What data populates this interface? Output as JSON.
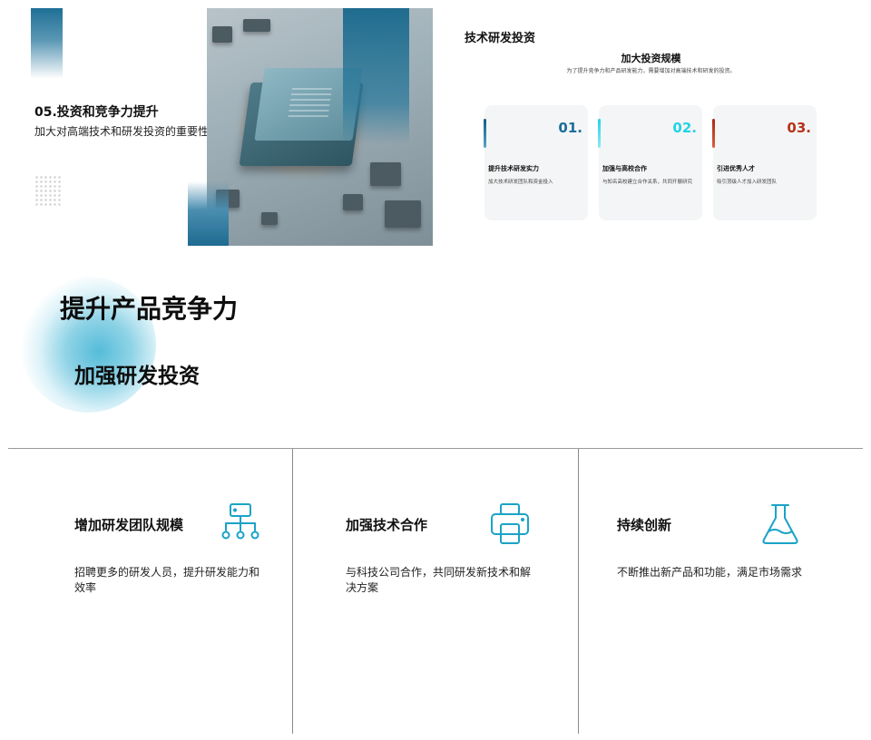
{
  "slide1": {
    "title": "05.投资和竞争力提升",
    "subtitle": "加大对高端技术和研发投资的重要性"
  },
  "slide2": {
    "heading": "技术研发投资",
    "title": "加大投资规模",
    "description": "为了提升竞争力和产品研发能力，需要增加对高端技术和研发的投资。",
    "cards": [
      {
        "num": "01.",
        "title": "提升技术研发实力",
        "text": "加大技术研发团队和资金投入",
        "color": "#1a6e9a"
      },
      {
        "num": "02.",
        "title": "加强与高校合作",
        "text": "与知名高校建立合作关系，共同开展研究",
        "color": "#22d3e6"
      },
      {
        "num": "03.",
        "title": "引进优秀人才",
        "text": "吸引顶级人才加入研发团队",
        "color": "#b8321a"
      }
    ]
  },
  "slide3": {
    "line1": "提升产品竞争力",
    "line2": "加强研发投资"
  },
  "slide4": {
    "accent": "#1aa3c7",
    "columns": [
      {
        "title": "增加研发团队规模",
        "text": "招聘更多的研发人员，提升研发能力和效率",
        "icon": "org-chart-icon"
      },
      {
        "title": "加强技术合作",
        "text": "与科技公司合作，共同研发新技术和解决方案",
        "icon": "printer-icon"
      },
      {
        "title": "持续创新",
        "text": "不断推出新产品和功能，满足市场需求",
        "icon": "flask-icon"
      }
    ]
  }
}
